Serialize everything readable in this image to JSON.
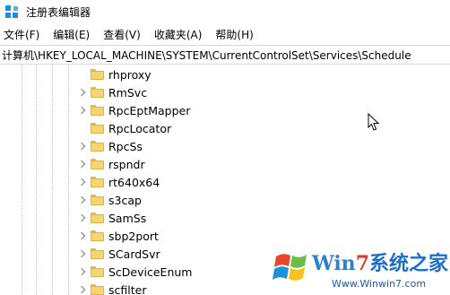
{
  "window": {
    "title": "注册表编辑器"
  },
  "menu": [
    {
      "label": "文件(F)"
    },
    {
      "label": "编辑(E)"
    },
    {
      "label": "查看(V)"
    },
    {
      "label": "收藏夹(A)"
    },
    {
      "label": "帮助(H)"
    }
  ],
  "address": {
    "path": "计算机\\HKEY_LOCAL_MACHINE\\SYSTEM\\CurrentControlSet\\Services\\Schedule"
  },
  "tree": {
    "items": [
      {
        "label": "rhproxy",
        "expandable": false
      },
      {
        "label": "RmSvc",
        "expandable": true
      },
      {
        "label": "RpcEptMapper",
        "expandable": true
      },
      {
        "label": "RpcLocator",
        "expandable": false
      },
      {
        "label": "RpcSs",
        "expandable": true
      },
      {
        "label": "rspndr",
        "expandable": true
      },
      {
        "label": "rt640x64",
        "expandable": true
      },
      {
        "label": "s3cap",
        "expandable": true
      },
      {
        "label": "SamSs",
        "expandable": true
      },
      {
        "label": "sbp2port",
        "expandable": true
      },
      {
        "label": "SCardSvr",
        "expandable": true
      },
      {
        "label": "ScDeviceEnum",
        "expandable": true
      },
      {
        "label": "scfilter",
        "expandable": true
      }
    ]
  },
  "watermark": {
    "brand_win": "Win",
    "brand_seven": "7",
    "brand_rest": "系统之家",
    "url": "Www.Winwin7.com"
  }
}
